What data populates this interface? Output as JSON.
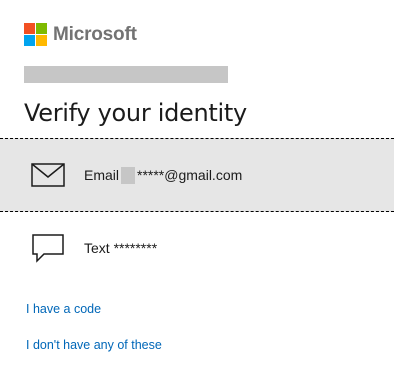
{
  "brand": {
    "name": "Microsoft",
    "colors": [
      "#f25022",
      "#7fba00",
      "#00a4ef",
      "#ffb900"
    ]
  },
  "title": "Verify your identity",
  "options": [
    {
      "icon": "envelope-icon",
      "label_prefix": "Email",
      "label_suffix": "*****@gmail.com",
      "selected": true
    },
    {
      "icon": "chat-bubble-icon",
      "label": "Text ********",
      "selected": false
    }
  ],
  "links": {
    "have_code": "I have a code",
    "none_of_these": "I don't have any of these"
  },
  "colors": {
    "link": "#0067b8",
    "selected_bg": "#e6e6e6",
    "redacted": "#c6c6c6"
  }
}
